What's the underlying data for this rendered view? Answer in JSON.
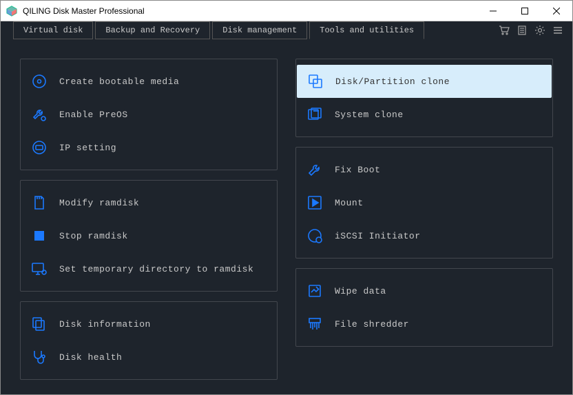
{
  "window": {
    "title": "QILING Disk Master Professional"
  },
  "tabs": [
    {
      "label": "Virtual disk"
    },
    {
      "label": "Backup and Recovery"
    },
    {
      "label": "Disk management"
    },
    {
      "label": "Tools and utilities"
    }
  ],
  "left_panels": [
    {
      "items": [
        {
          "id": "create-bootable-media",
          "label": "Create bootable media"
        },
        {
          "id": "enable-preos",
          "label": "Enable PreOS"
        },
        {
          "id": "ip-setting",
          "label": "IP setting"
        }
      ]
    },
    {
      "items": [
        {
          "id": "modify-ramdisk",
          "label": "Modify ramdisk"
        },
        {
          "id": "stop-ramdisk",
          "label": "Stop ramdisk"
        },
        {
          "id": "temp-dir-ramdisk",
          "label": "Set temporary directory to ramdisk"
        }
      ]
    },
    {
      "items": [
        {
          "id": "disk-information",
          "label": "Disk information"
        },
        {
          "id": "disk-health",
          "label": "Disk health"
        }
      ]
    }
  ],
  "right_panels": [
    {
      "items": [
        {
          "id": "disk-partition-clone",
          "label": "Disk/Partition clone",
          "selected": true
        },
        {
          "id": "system-clone",
          "label": "System clone"
        }
      ]
    },
    {
      "items": [
        {
          "id": "fix-boot",
          "label": "Fix Boot"
        },
        {
          "id": "mount",
          "label": "Mount"
        },
        {
          "id": "iscsi-initiator",
          "label": "iSCSI Initiator"
        }
      ]
    },
    {
      "items": [
        {
          "id": "wipe-data",
          "label": "Wipe data"
        },
        {
          "id": "file-shredder",
          "label": "File shredder"
        }
      ]
    }
  ]
}
